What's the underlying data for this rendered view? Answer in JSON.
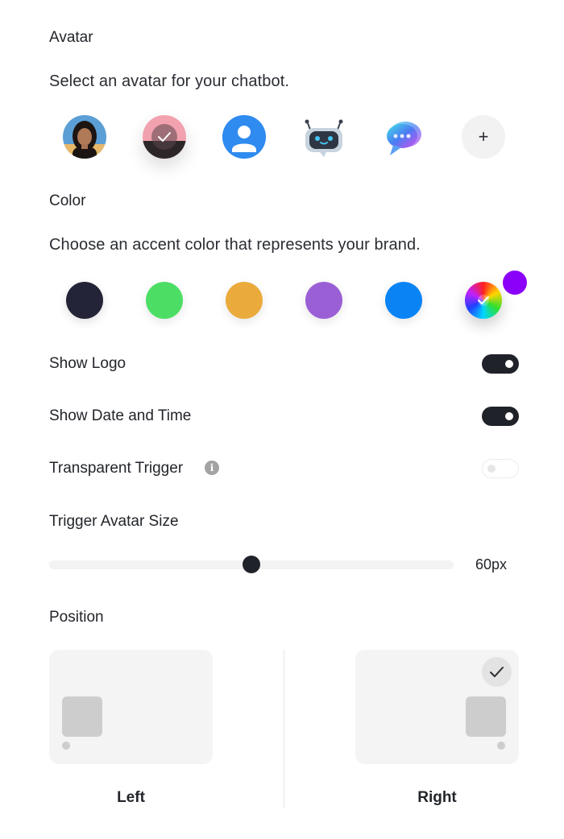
{
  "avatar_section": {
    "title": "Avatar",
    "description": "Select an avatar for your chatbot.",
    "avatars": [
      {
        "name": "photo-woman",
        "selected": false
      },
      {
        "name": "photo-pink",
        "selected": true
      },
      {
        "name": "user-silhouette-icon",
        "selected": false
      },
      {
        "name": "robot-icon",
        "selected": false
      },
      {
        "name": "chat-bubble-icon",
        "selected": false
      }
    ],
    "add_label": "+"
  },
  "color_section": {
    "title": "Color",
    "description": "Choose an accent color that represents your brand.",
    "swatches": [
      "#242438",
      "#4cde64",
      "#eaab3c",
      "#9b5fd5",
      "#0a84f5"
    ],
    "custom_selected": true,
    "custom_badge_color": "#8b00f8"
  },
  "settings": {
    "show_logo": {
      "label": "Show Logo",
      "enabled": true
    },
    "show_date_time": {
      "label": "Show Date and Time",
      "enabled": true
    },
    "transparent_trigger": {
      "label": "Transparent Trigger",
      "info_icon": "i",
      "enabled": false
    }
  },
  "trigger_size": {
    "label": "Trigger Avatar Size",
    "value": "60px",
    "fraction": 0.5
  },
  "position": {
    "title": "Position",
    "options": [
      {
        "label": "Left",
        "selected": false
      },
      {
        "label": "Right",
        "selected": true
      }
    ]
  },
  "colors": {
    "text": "#22252a",
    "toggle_on": "#1f2329",
    "card_bg": "#f4f4f4"
  }
}
